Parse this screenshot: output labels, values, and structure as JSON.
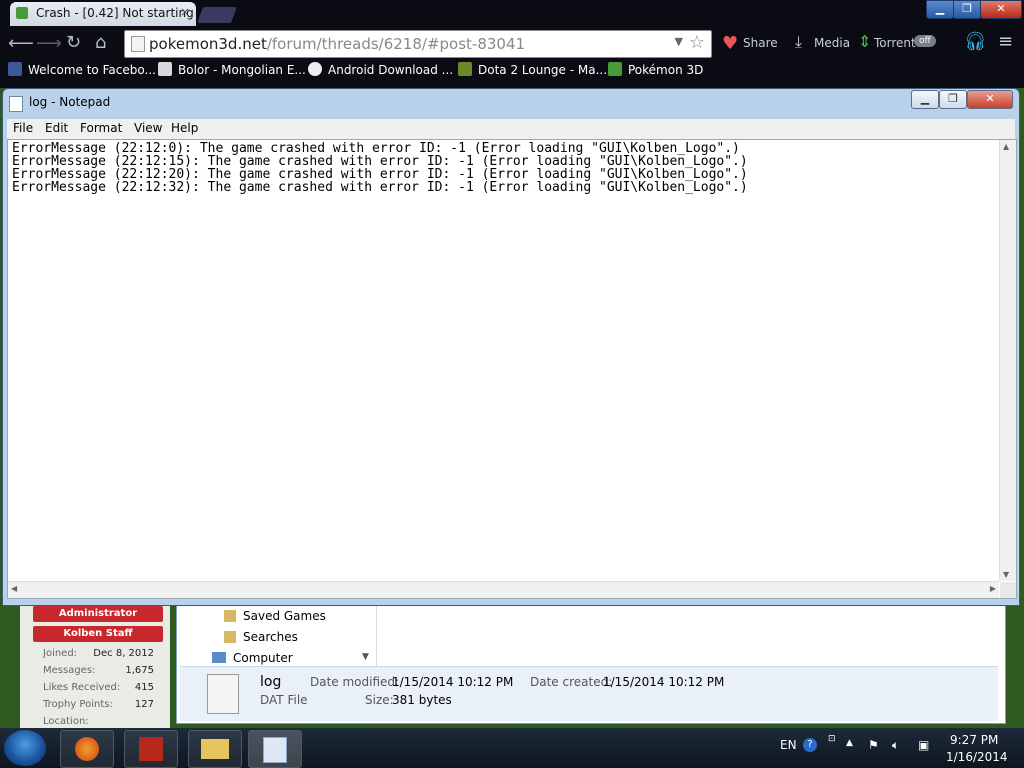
{
  "browser": {
    "tab_title": "Crash - [0.42] Not starting",
    "tab_close": "×",
    "url_host": "pokemon3d.net",
    "url_path": "/forum/threads/6218/#post-83041",
    "extensions": {
      "share": "Share",
      "media": "Media",
      "torrent": "Torrent",
      "torrent_state": "off"
    },
    "bookmarks": [
      {
        "label": "Welcome to Facebo...",
        "color": "#3b5998"
      },
      {
        "label": "Bolor - Mongolian E...",
        "color": "#d8d8d8"
      },
      {
        "label": "Android Download ...",
        "color": "#222222"
      },
      {
        "label": "Dota 2 Lounge - Ma...",
        "color": "#6a8a2a"
      },
      {
        "label": "Pokémon 3D",
        "color": "#4a9a3a"
      }
    ]
  },
  "forum_sidebar": {
    "roles": [
      "Administrator",
      "Kolben Staff"
    ],
    "stats": [
      {
        "label": "Joined:",
        "value": "Dec 8, 2012"
      },
      {
        "label": "Messages:",
        "value": "1,675"
      },
      {
        "label": "Likes Received:",
        "value": "415"
      },
      {
        "label": "Trophy Points:",
        "value": "127"
      },
      {
        "label": "Location:",
        "value": ""
      }
    ]
  },
  "explorer": {
    "tree": [
      "Saved Games",
      "Searches",
      "Computer"
    ],
    "file_name": "log",
    "file_type": "DAT File",
    "date_modified_label": "Date modified:",
    "date_modified": "1/15/2014 10:12 PM",
    "date_created_label": "Date created:",
    "date_created": "1/15/2014 10:12 PM",
    "size_label": "Size:",
    "size": "381 bytes"
  },
  "notepad": {
    "title": "log - Notepad",
    "menus": [
      "File",
      "Edit",
      "Format",
      "View",
      "Help"
    ],
    "lines": [
      "ErrorMessage (22:12:0): The game crashed with error ID: -1 (Error loading \"GUI\\Kolben_Logo\".)",
      "ErrorMessage (22:12:15): The game crashed with error ID: -1 (Error loading \"GUI\\Kolben_Logo\".)",
      "ErrorMessage (22:12:20): The game crashed with error ID: -1 (Error loading \"GUI\\Kolben_Logo\".)",
      "ErrorMessage (22:12:32): The game crashed with error ID: -1 (Error loading \"GUI\\Kolben_Logo\".)"
    ]
  },
  "taskbar": {
    "language": "EN",
    "time": "9:27 PM",
    "date": "1/16/2014"
  }
}
